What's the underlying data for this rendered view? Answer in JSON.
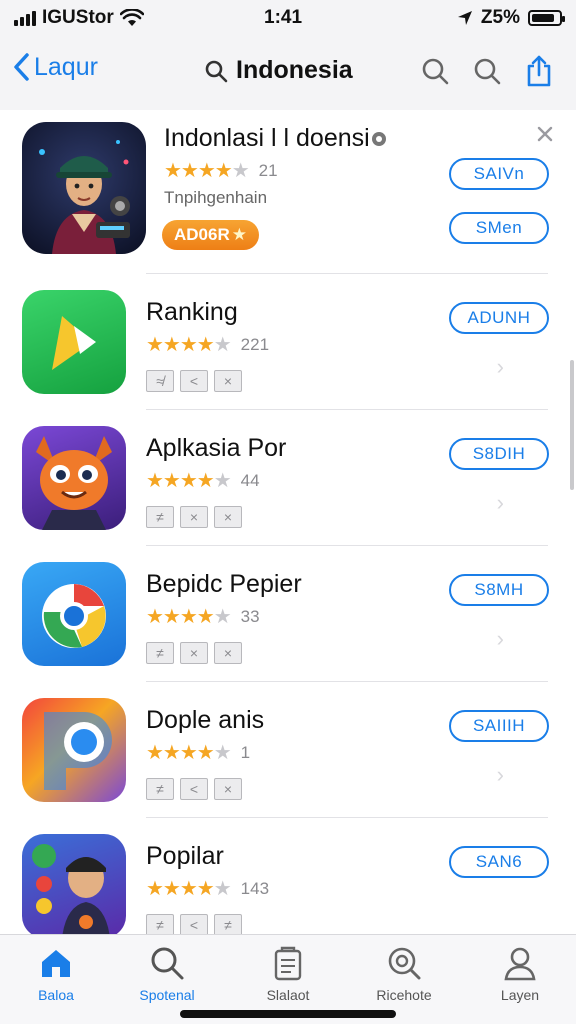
{
  "status": {
    "carrier": "IGUStor",
    "time": "1:41",
    "battery": "Z5%"
  },
  "nav": {
    "back_label": "Laqur",
    "title": "Indonesia",
    "icons": [
      "search-icon",
      "search-icon",
      "share-icon"
    ]
  },
  "apps": [
    {
      "name": "Indonlasi l l doensi",
      "rating_count": "21",
      "stars": 4,
      "subtitle": "Tnpihgenhain",
      "badge": "AD06R",
      "buttons": [
        "SAIVn",
        "SMen"
      ]
    },
    {
      "name": "Ranking",
      "rating_count": "221",
      "stars": 4,
      "tags": [
        "≉",
        "<",
        "×"
      ],
      "button": "ADUNH"
    },
    {
      "name": "Aplkasia Por",
      "rating_count": "44",
      "stars": 4,
      "tags": [
        "≠",
        "×",
        "×"
      ],
      "button": "S8DIH"
    },
    {
      "name": "Bepidc Pepier",
      "rating_count": "33",
      "stars": 4,
      "tags": [
        "≠",
        "×",
        "×"
      ],
      "button": "S8MH"
    },
    {
      "name": "Dople anis",
      "rating_count": "1",
      "stars": 4,
      "tags": [
        "≠",
        "<",
        "×"
      ],
      "button": "SAIIIH"
    },
    {
      "name": "Popilar",
      "rating_count": "143",
      "stars": 4,
      "tags": [
        "≠",
        "<",
        "≠"
      ],
      "button": "SAN6"
    }
  ],
  "tabs": [
    {
      "label": "Baloa",
      "icon": "home-icon",
      "active": true
    },
    {
      "label": "Spotenal",
      "icon": "search-icon",
      "active": true
    },
    {
      "label": "Slalaot",
      "icon": "apps-icon",
      "active": false
    },
    {
      "label": "Ricehote",
      "icon": "search-circle-icon",
      "active": false
    },
    {
      "label": "Layen",
      "icon": "person-icon",
      "active": false
    }
  ],
  "colors": {
    "accent": "#1a7ee8",
    "star": "#f5a623",
    "badge": "#ee7f16"
  }
}
